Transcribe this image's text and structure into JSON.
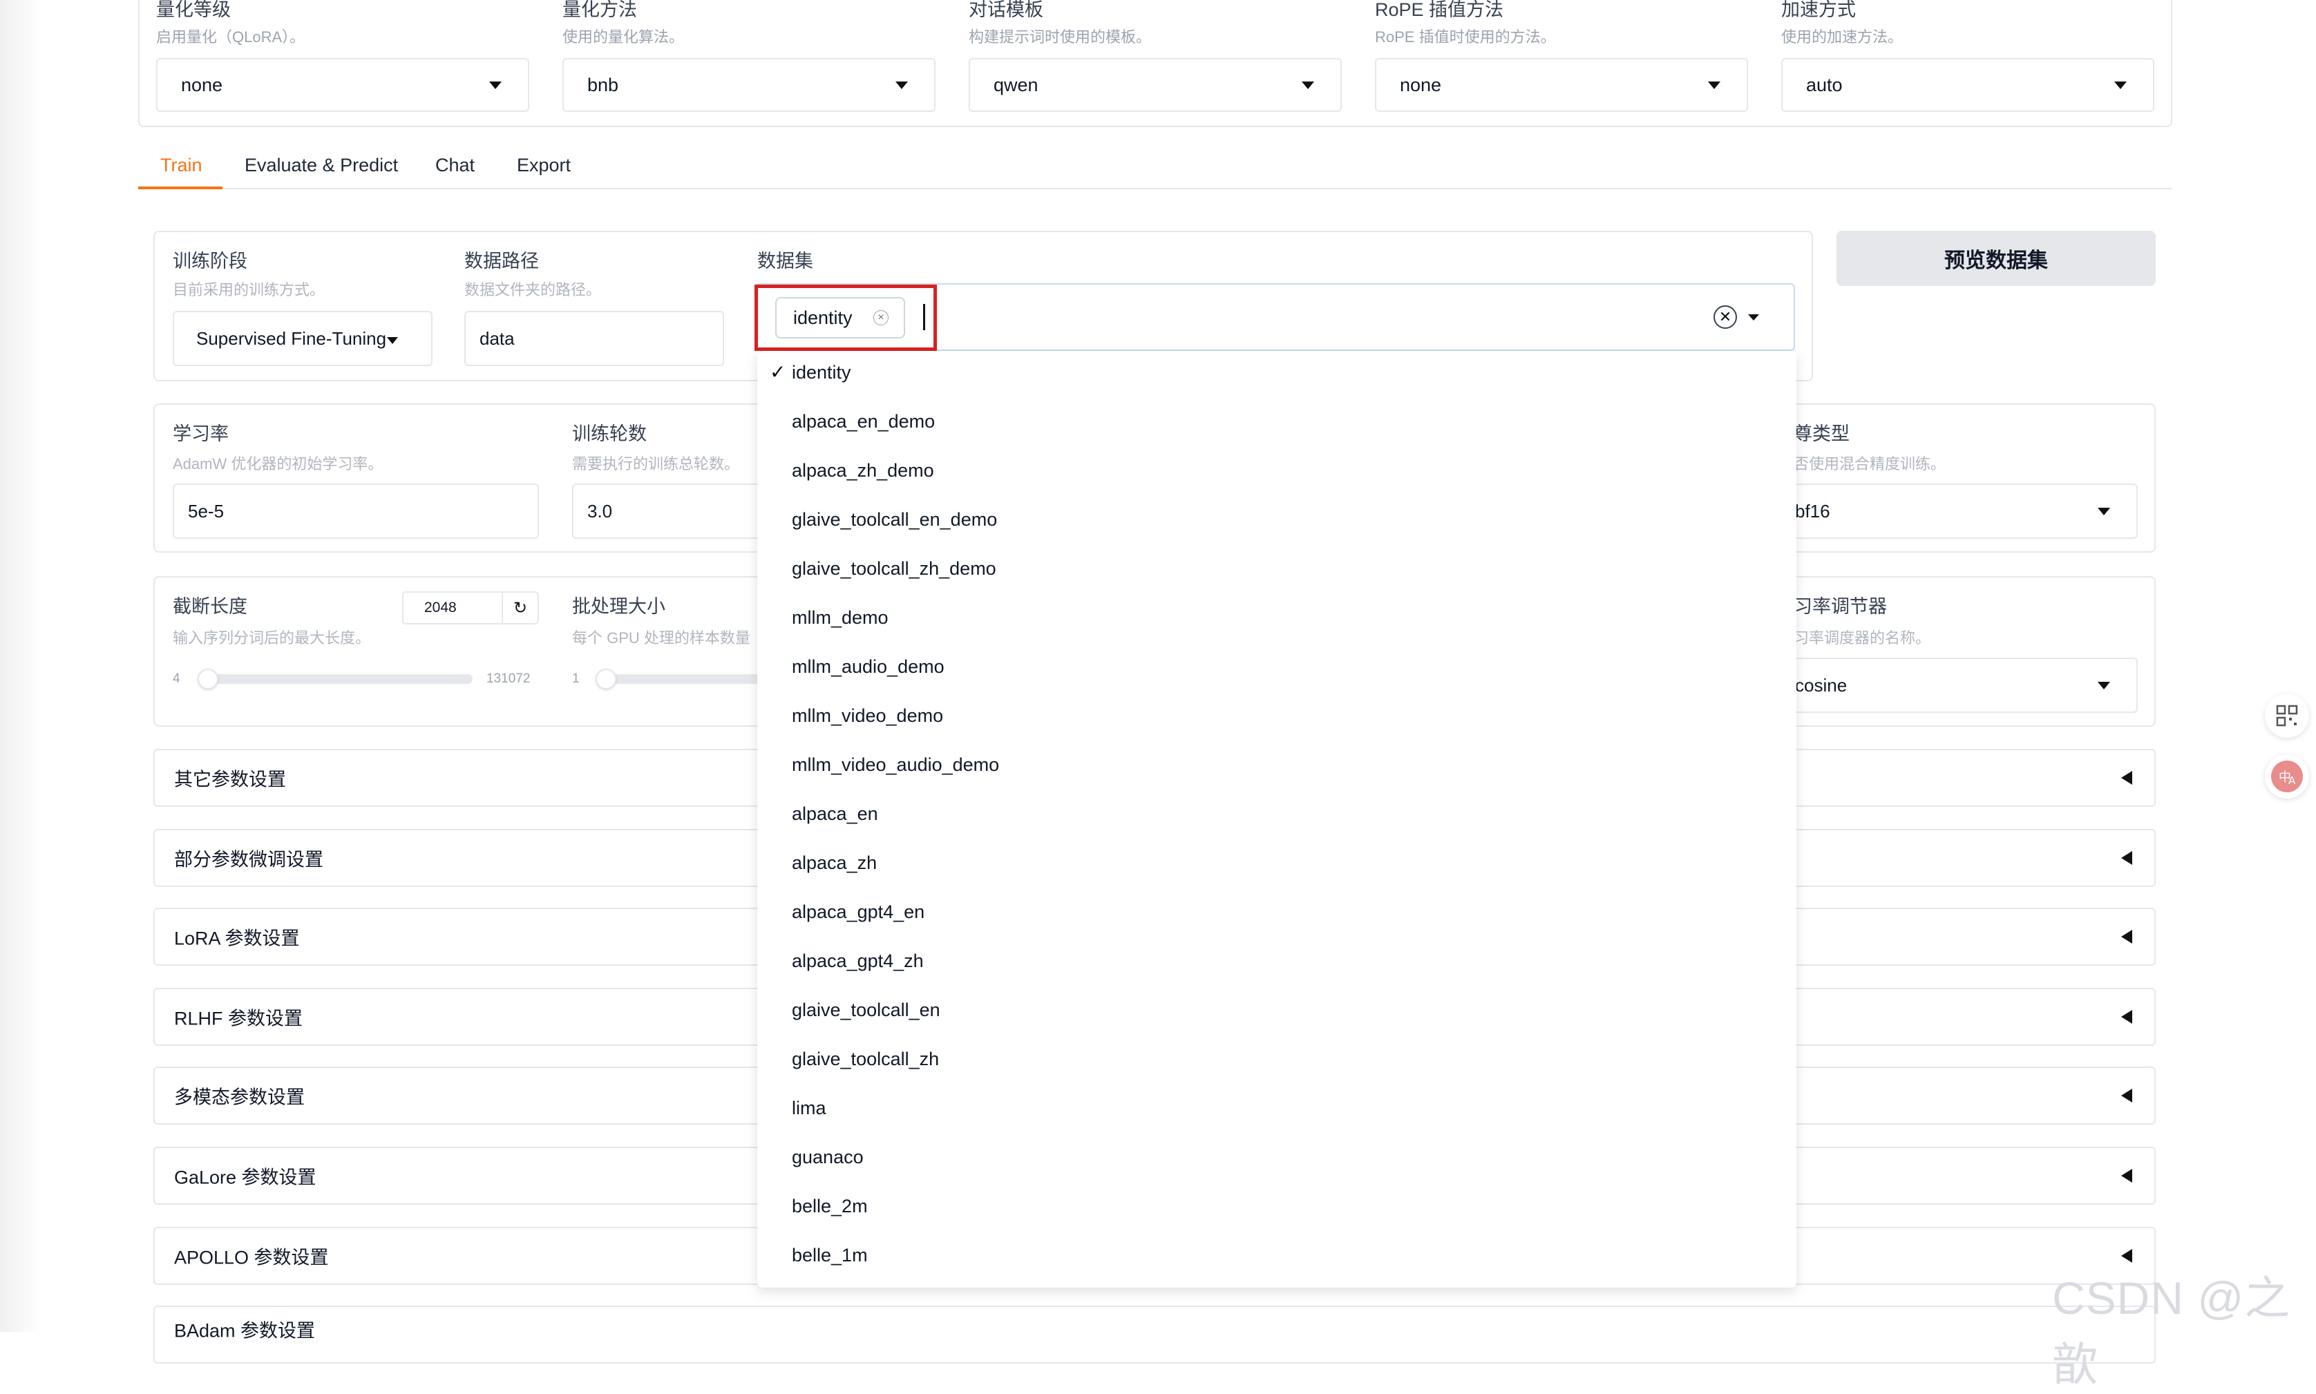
{
  "top": {
    "fields": [
      {
        "label": "量化等级",
        "desc": "启用量化（QLoRA）。",
        "value": "none"
      },
      {
        "label": "量化方法",
        "desc": "使用的量化算法。",
        "value": "bnb"
      },
      {
        "label": "对话模板",
        "desc": "构建提示词时使用的模板。",
        "value": "qwen"
      },
      {
        "label": "RoPE 插值方法",
        "desc": "RoPE 插值时使用的方法。",
        "value": "none"
      },
      {
        "label": "加速方式",
        "desc": "使用的加速方法。",
        "value": "auto"
      }
    ]
  },
  "tabs": [
    "Train",
    "Evaluate & Predict",
    "Chat",
    "Export"
  ],
  "train": {
    "stage": {
      "label": "训练阶段",
      "desc": "目前采用的训练方式。",
      "value": "Supervised Fine-Tuning"
    },
    "data_dir": {
      "label": "数据路径",
      "desc": "数据文件夹的路径。",
      "value": "data"
    },
    "dataset": {
      "label": "数据集",
      "chip": "identity",
      "chip_close": "×",
      "clear": "✕"
    },
    "preview_button": "预览数据集",
    "learning_rate": {
      "label": "学习率",
      "desc": "AdamW 优化器的初始学习率。",
      "value": "5e-5"
    },
    "epochs": {
      "label": "训练轮数",
      "desc": "需要执行的训练总轮数。",
      "value": "3.0"
    },
    "compute_type": {
      "label": "尊类型",
      "desc": "否使用混合精度训练。",
      "value": "bf16"
    },
    "cutoff_len": {
      "label": "截断长度",
      "desc": "输入序列分词后的最大长度。",
      "value": "2048",
      "min": "4",
      "max": "131072",
      "fraction": 0.0
    },
    "batch_size": {
      "label": "批处理大小",
      "desc": "每个 GPU 处理的样本数量",
      "min": "1"
    },
    "lr_scheduler": {
      "label": "习率调节器",
      "desc": "习率调度器的名称。",
      "value": "cosine"
    }
  },
  "accordions": [
    "其它参数设置",
    "部分参数微调设置",
    "LoRA 参数设置",
    "RLHF 参数设置",
    "多模态参数设置",
    "GaLore 参数设置",
    "APOLLO 参数设置",
    "BAdam 参数设置"
  ],
  "dropdown": {
    "check": "✓",
    "options": [
      "identity",
      "alpaca_en_demo",
      "alpaca_zh_demo",
      "glaive_toolcall_en_demo",
      "glaive_toolcall_zh_demo",
      "mllm_demo",
      "mllm_audio_demo",
      "mllm_video_demo",
      "mllm_video_audio_demo",
      "alpaca_en",
      "alpaca_zh",
      "alpaca_gpt4_en",
      "alpaca_gpt4_zh",
      "glaive_toolcall_en",
      "glaive_toolcall_zh",
      "lima",
      "guanaco",
      "belle_2m",
      "belle_1m"
    ]
  },
  "watermark": "CSDN @之歆",
  "colors": {
    "accent": "#f97316",
    "highlight_box": "#d92121"
  }
}
